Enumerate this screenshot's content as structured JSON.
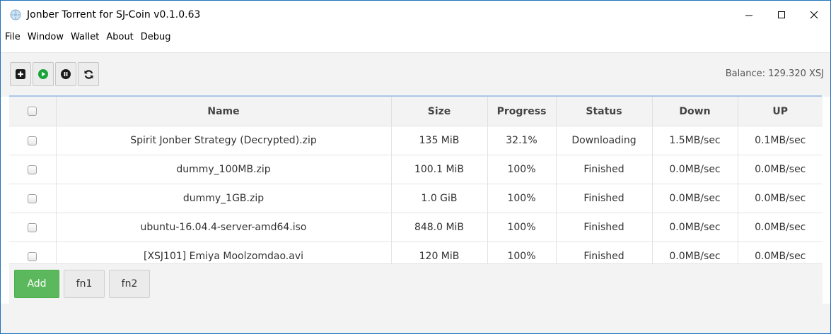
{
  "window": {
    "title": "Jonber Torrent for SJ-Coin v0.1.0.63",
    "minimize_glyph": "—",
    "maximize_glyph": "☐",
    "close_glyph": "✕"
  },
  "menu": [
    "File",
    "Window",
    "Wallet",
    "About",
    "Debug"
  ],
  "toolbar": {
    "icons": [
      "add-square-icon",
      "play-circle-icon",
      "pause-circle-icon",
      "refresh-icon"
    ],
    "balance": "Balance: 129.320 XSJ"
  },
  "table": {
    "headers": [
      "Name",
      "Size",
      "Progress",
      "Status",
      "Down",
      "UP"
    ],
    "rows": [
      {
        "name": "Spirit Jonber Strategy (Decrypted).zip",
        "size": "135 MiB",
        "progress": "32.1%",
        "status": "Downloading",
        "down": "1.5MB/sec",
        "up": "0.1MB/sec"
      },
      {
        "name": "dummy_100MB.zip",
        "size": "100.1 MiB",
        "progress": "100%",
        "status": "Finished",
        "down": "0.0MB/sec",
        "up": "0.0MB/sec"
      },
      {
        "name": "dummy_1GB.zip",
        "size": "1.0 GiB",
        "progress": "100%",
        "status": "Finished",
        "down": "0.0MB/sec",
        "up": "0.0MB/sec"
      },
      {
        "name": "ubuntu-16.04.4-server-amd64.iso",
        "size": "848.0 MiB",
        "progress": "100%",
        "status": "Finished",
        "down": "0.0MB/sec",
        "up": "0.0MB/sec"
      },
      {
        "name": "[XSJ101] Emiya Moolzomdao.avi",
        "size": "120 MiB",
        "progress": "100%",
        "status": "Finished",
        "down": "0.0MB/sec",
        "up": "0.0MB/sec"
      }
    ]
  },
  "buttons": {
    "add": "Add",
    "fn1": "fn1",
    "fn2": "fn2"
  },
  "colors": {
    "add_button": "#5cb85c",
    "play_icon": "#1aa33a",
    "window_border": "#1e73be"
  }
}
